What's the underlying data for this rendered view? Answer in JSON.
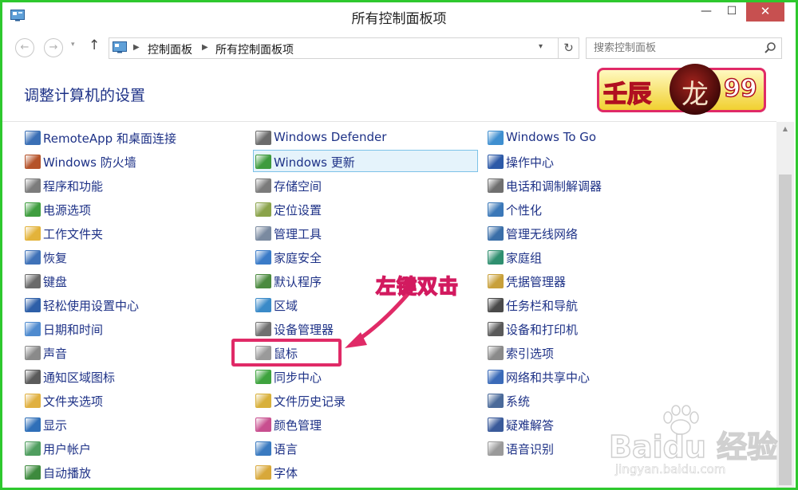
{
  "window": {
    "title": "所有控制面板项",
    "icon": "control-panel-icon"
  },
  "titlebar_buttons": {
    "minimize": "—",
    "maximize": "☐",
    "close": "✕"
  },
  "nav": {
    "back": "←",
    "forward": "→",
    "recent": "▾",
    "up": "↑",
    "refresh": "↻",
    "address_dropdown": "▾"
  },
  "breadcrumb": [
    "控制面板",
    "所有控制面板项"
  ],
  "breadcrumb_separator": "▶",
  "search": {
    "placeholder": "搜索控制面板",
    "value": ""
  },
  "heading": "调整计算机的设置",
  "badge": {
    "left_text": "壬辰",
    "logo_glyph": "龙",
    "right_text": "99"
  },
  "columns": [
    {
      "items": [
        {
          "label": "RemoteApp 和桌面连接",
          "icon": "remote-desktop-icon",
          "color": "#3a6fb5"
        },
        {
          "label": "Windows 防火墙",
          "icon": "firewall-icon",
          "color": "#b5532a"
        },
        {
          "label": "程序和功能",
          "icon": "programs-icon",
          "color": "#7c7c7c"
        },
        {
          "label": "电源选项",
          "icon": "power-options-icon",
          "color": "#3f9e3f"
        },
        {
          "label": "工作文件夹",
          "icon": "work-folders-icon",
          "color": "#e3b33a"
        },
        {
          "label": "恢复",
          "icon": "recovery-icon",
          "color": "#3f72b8"
        },
        {
          "label": "键盘",
          "icon": "keyboard-icon",
          "color": "#6a6a6a"
        },
        {
          "label": "轻松使用设置中心",
          "icon": "ease-of-access-icon",
          "color": "#2e5fa8"
        },
        {
          "label": "日期和时间",
          "icon": "date-time-icon",
          "color": "#4f8bcf"
        },
        {
          "label": "声音",
          "icon": "sound-icon",
          "color": "#8a8a8a"
        },
        {
          "label": "通知区域图标",
          "icon": "notification-icons-icon",
          "color": "#5b5b5b"
        },
        {
          "label": "文件夹选项",
          "icon": "folder-options-icon",
          "color": "#e0b040"
        },
        {
          "label": "显示",
          "icon": "display-icon",
          "color": "#2f6fb8"
        },
        {
          "label": "用户帐户",
          "icon": "user-accounts-icon",
          "color": "#4f9e5f"
        },
        {
          "label": "自动播放",
          "icon": "autoplay-icon",
          "color": "#3d8a3d"
        }
      ]
    },
    {
      "items": [
        {
          "label": "Windows Defender",
          "icon": "windows-defender-icon",
          "color": "#6b6b6b"
        },
        {
          "label": "Windows 更新",
          "icon": "windows-update-icon",
          "color": "#3e9b3e",
          "selected": true
        },
        {
          "label": "存储空间",
          "icon": "storage-spaces-icon",
          "color": "#7b7b7b"
        },
        {
          "label": "定位设置",
          "icon": "location-settings-icon",
          "color": "#8aa34a"
        },
        {
          "label": "管理工具",
          "icon": "admin-tools-icon",
          "color": "#7a8aa0"
        },
        {
          "label": "家庭安全",
          "icon": "family-safety-icon",
          "color": "#3a7bc8"
        },
        {
          "label": "默认程序",
          "icon": "default-programs-icon",
          "color": "#4b8a3f"
        },
        {
          "label": "区域",
          "icon": "region-icon",
          "color": "#3a8ac8"
        },
        {
          "label": "设备管理器",
          "icon": "device-manager-icon",
          "color": "#707070"
        },
        {
          "label": "鼠标",
          "icon": "mouse-icon",
          "color": "#9a9a9a"
        },
        {
          "label": "同步中心",
          "icon": "sync-center-icon",
          "color": "#3ea33e"
        },
        {
          "label": "文件历史记录",
          "icon": "file-history-icon",
          "color": "#d8b03a"
        },
        {
          "label": "颜色管理",
          "icon": "color-management-icon",
          "color": "#c84f8f"
        },
        {
          "label": "语言",
          "icon": "language-icon",
          "color": "#3a7ac0"
        },
        {
          "label": "字体",
          "icon": "fonts-icon",
          "color": "#d8a83a"
        }
      ]
    },
    {
      "items": [
        {
          "label": "Windows To Go",
          "icon": "windows-to-go-icon",
          "color": "#3f8fd0"
        },
        {
          "label": "操作中心",
          "icon": "action-center-icon",
          "color": "#2d5aa8"
        },
        {
          "label": "电话和调制解调器",
          "icon": "phone-modem-icon",
          "color": "#6f6f6f"
        },
        {
          "label": "个性化",
          "icon": "personalization-icon",
          "color": "#3b78b8"
        },
        {
          "label": "管理无线网络",
          "icon": "wireless-networks-icon",
          "color": "#3a6ea8"
        },
        {
          "label": "家庭组",
          "icon": "homegroup-icon",
          "color": "#2f8f6f"
        },
        {
          "label": "凭据管理器",
          "icon": "credential-manager-icon",
          "color": "#c8a03a"
        },
        {
          "label": "任务栏和导航",
          "icon": "taskbar-icon",
          "color": "#4a4a4a"
        },
        {
          "label": "设备和打印机",
          "icon": "devices-printers-icon",
          "color": "#5a5a5a"
        },
        {
          "label": "索引选项",
          "icon": "indexing-options-icon",
          "color": "#8a8a8a"
        },
        {
          "label": "网络和共享中心",
          "icon": "network-sharing-icon",
          "color": "#3a6ab8"
        },
        {
          "label": "系统",
          "icon": "system-icon",
          "color": "#4a6a9a"
        },
        {
          "label": "疑难解答",
          "icon": "troubleshooting-icon",
          "color": "#3a5a9a"
        },
        {
          "label": "语音识别",
          "icon": "speech-recognition-icon",
          "color": "#9a9a9a"
        }
      ]
    }
  ],
  "annotation": {
    "text": "左键双击",
    "color": "#e02a67"
  },
  "watermark": {
    "text": "Baidu 经验",
    "url": "jingyan.baidu.com"
  }
}
